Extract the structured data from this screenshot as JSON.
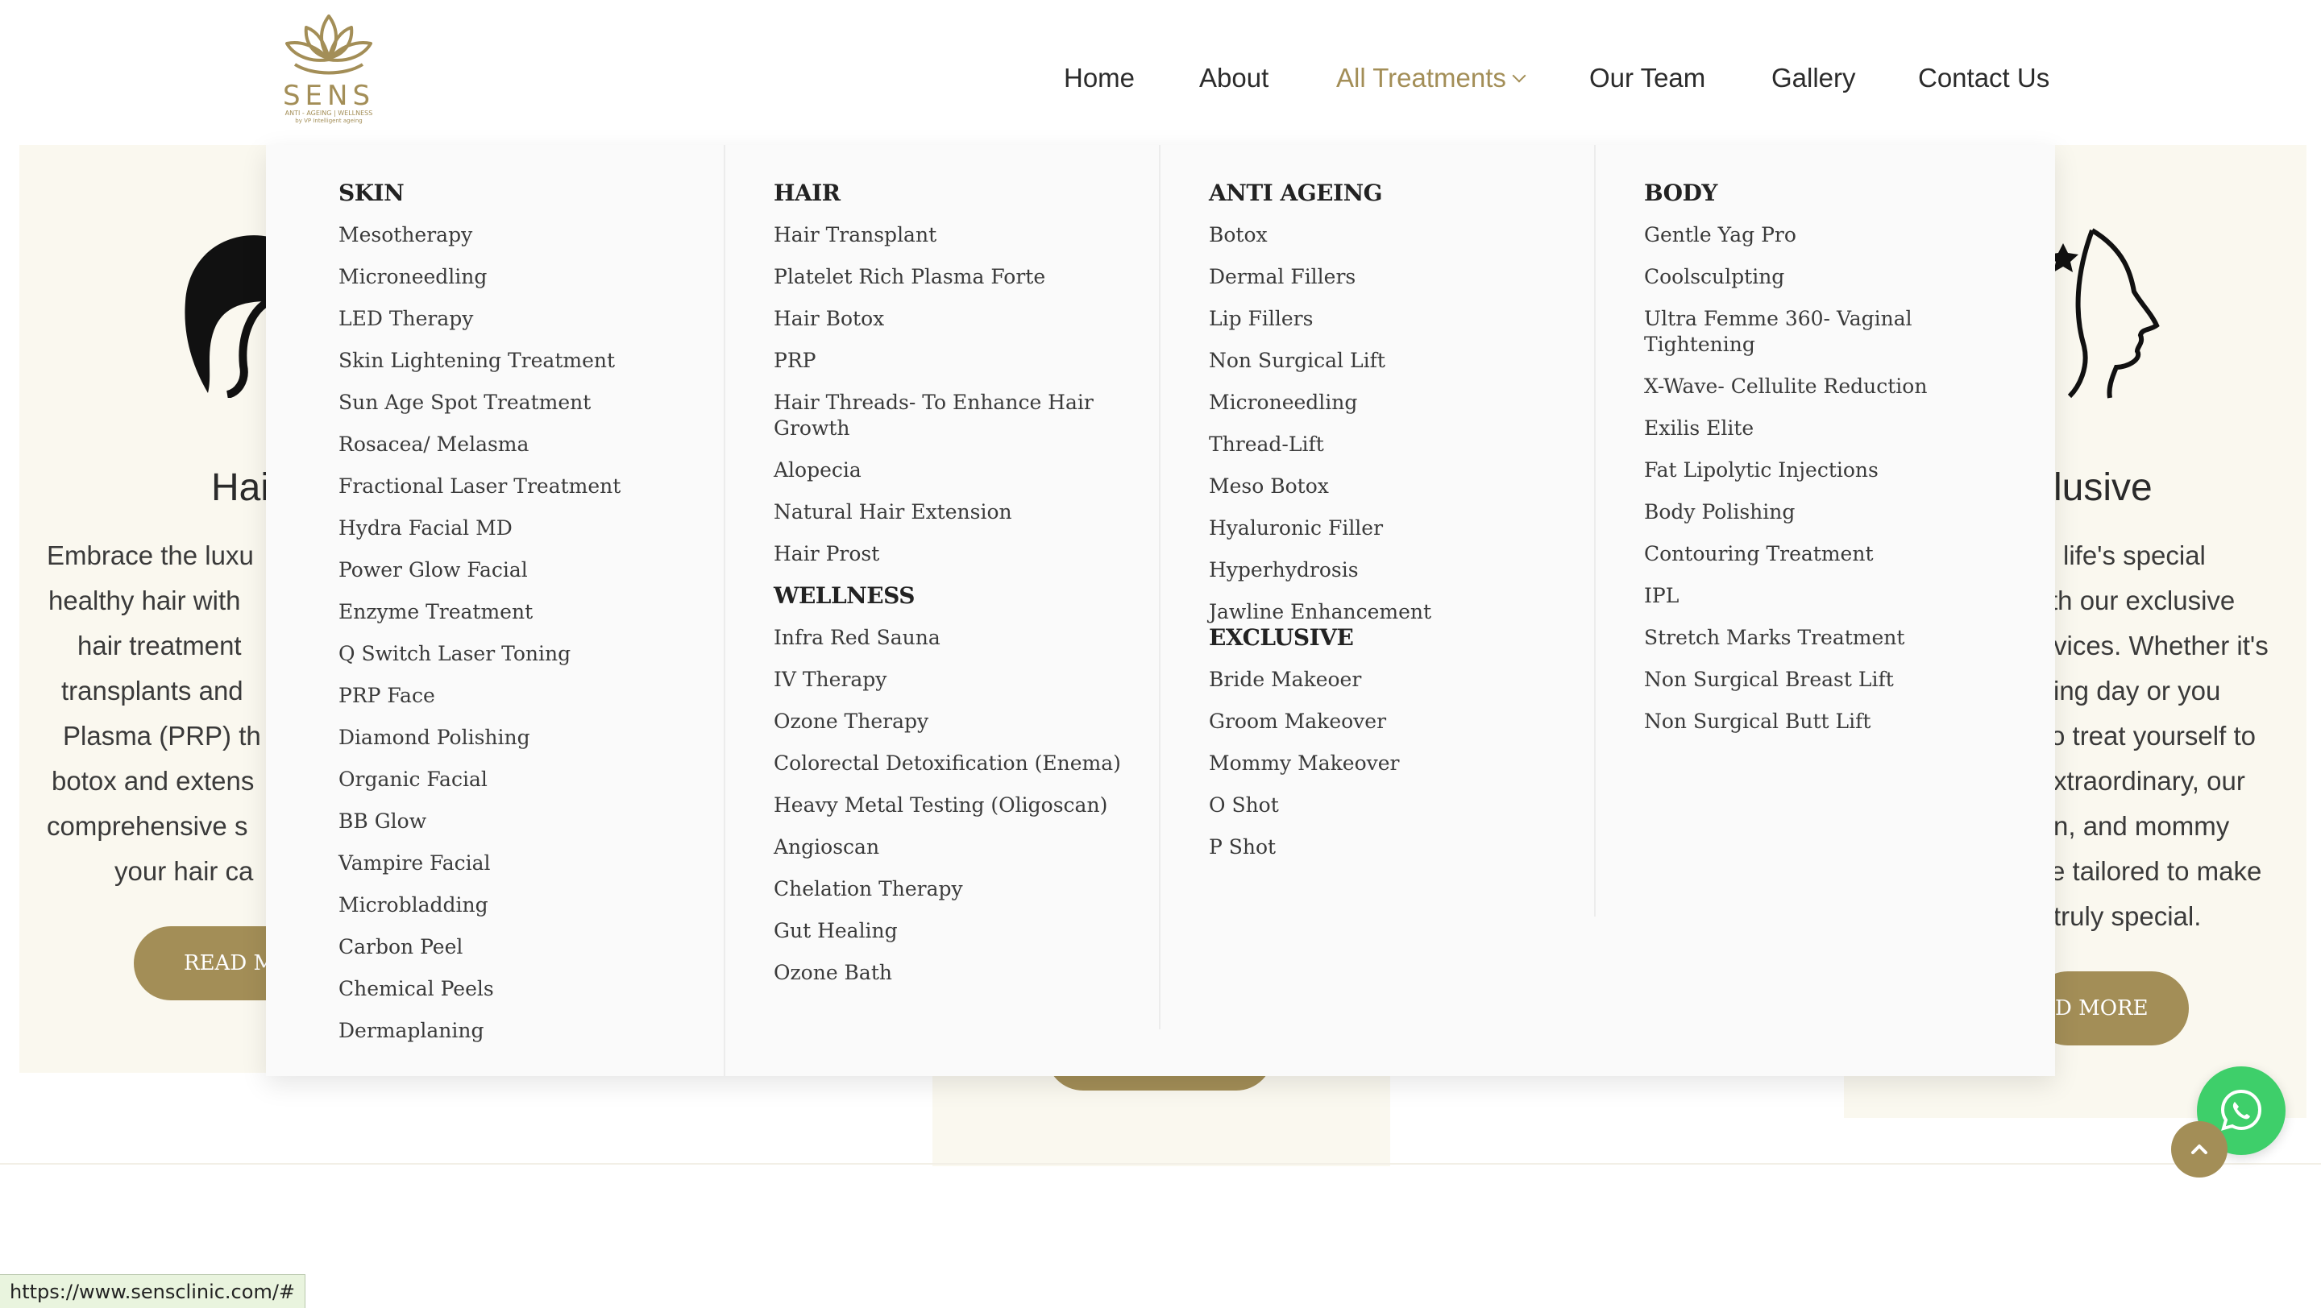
{
  "header": {
    "logo": {
      "word": "SENS",
      "tagline": "ANTI - AGEING | WELLNESS",
      "sub": "by VP Intelligent ageing"
    },
    "nav": [
      {
        "label": "Home"
      },
      {
        "label": "About"
      },
      {
        "label": "All Treatments",
        "active": true
      },
      {
        "label": "Our Team"
      },
      {
        "label": "Gallery"
      },
      {
        "label": "Contact Us"
      }
    ]
  },
  "background_cards": {
    "left": {
      "title": "Hai",
      "lines": [
        "Embrace the luxu",
        "healthy hair with",
        "hair treatment",
        "transplants and",
        "Plasma (PRP) th",
        "botox and extens",
        "comprehensive s",
        "your hair ca"
      ],
      "button": "READ M"
    },
    "right": {
      "title": "lusive",
      "lines": [
        "life's special",
        "th our exclusive",
        "vices. Whether it's",
        "ing day or you",
        "o treat yourself to",
        "xtraordinary, our",
        "n, and mommy",
        "e tailored to make",
        "truly special."
      ],
      "button": "D MORE"
    }
  },
  "mega_menu": {
    "skin": {
      "heading": "SKIN",
      "items": [
        "Mesotherapy",
        "Microneedling",
        "LED Therapy",
        "Skin Lightening Treatment",
        "Sun Age Spot Treatment",
        "Rosacea/ Melasma",
        "Fractional Laser Treatment",
        "Hydra Facial MD",
        "Power Glow Facial",
        "Enzyme Treatment",
        "Q Switch Laser Toning",
        "PRP Face",
        "Diamond Polishing",
        "Organic Facial",
        "BB Glow",
        "Vampire Facial",
        "Microbladding",
        "Carbon Peel",
        "Chemical Peels",
        "Dermaplaning"
      ]
    },
    "hair": {
      "heading": "HAIR",
      "items": [
        "Hair Transplant",
        "Platelet Rich Plasma Forte",
        "Hair Botox",
        "PRP",
        "Hair Threads- To Enhance Hair",
        "Growth",
        "Alopecia",
        "Natural Hair Extension",
        "Hair Prost"
      ]
    },
    "wellness": {
      "heading": "WELLNESS",
      "items": [
        "Infra Red Sauna",
        "IV Therapy",
        "Ozone Therapy",
        "Colorectal Detoxification (Enema)",
        "Heavy Metal Testing (Oligoscan)",
        "Angioscan",
        "Chelation Therapy",
        "Gut Healing",
        "Ozone Bath"
      ]
    },
    "anti_ageing": {
      "heading": "ANTI AGEING",
      "items": [
        "Botox",
        "Dermal Fillers",
        "Lip Fillers",
        "Non Surgical Lift",
        "Microneedling",
        "Thread-Lift",
        "Meso Botox",
        "Hyaluronic Filler",
        "Hyperhydrosis",
        "Jawline Enhancement"
      ]
    },
    "exclusive": {
      "heading": "EXCLUSIVE",
      "items": [
        "Bride Makeoer",
        "Groom Makeover",
        "Mommy Makeover",
        "O Shot",
        "P Shot"
      ]
    },
    "body": {
      "heading": "BODY",
      "items": [
        "Gentle Yag Pro",
        "Coolsculpting",
        "Ultra Femme 360- Vaginal",
        "Tightening",
        "X-Wave- Cellulite Reduction",
        "Exilis Elite",
        "Fat Lipolytic Injections",
        "Body Polishing",
        "Contouring Treatment",
        "IPL",
        "Stretch Marks Treatment",
        "Non Surgical Breast Lift",
        "Non Surgical Butt Lift"
      ]
    }
  },
  "floating": {
    "whatsapp_icon": "whatsapp-icon",
    "scroll_top_icon": "chevron-up-icon"
  },
  "status_bar": {
    "url": "https://www.sensclinic.com/#"
  },
  "colors": {
    "accent": "#a38e57",
    "card_bg": "#faf8ef",
    "menu_bg": "#fafafa",
    "whatsapp": "#3ecf6a"
  }
}
